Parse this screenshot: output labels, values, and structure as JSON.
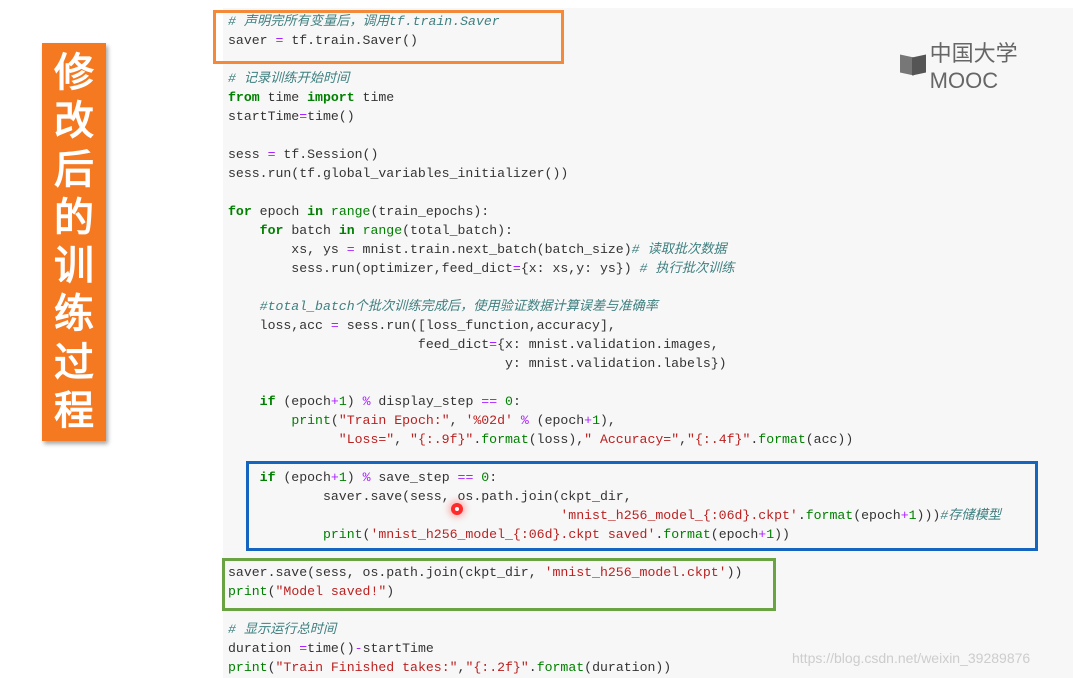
{
  "banner": {
    "chars": [
      "修",
      "改",
      "后",
      "的",
      "训",
      "练",
      "过",
      "程"
    ],
    "color": "#f47920"
  },
  "logo": {
    "text": "中国大学MOOC"
  },
  "watermark": "https://blog.csdn.net/weixin_39289876",
  "colors": {
    "comment": "#408080",
    "keyword": "#008000",
    "string": "#ba2121",
    "operator": "#aa22ff",
    "highlight_orange": "#f5893a",
    "highlight_blue": "#1565c0",
    "highlight_green": "#6aa341"
  },
  "code_lines": [
    [
      [
        "c",
        "# 声明完所有变量后，调用tf.train.Saver"
      ]
    ],
    [
      [
        "p",
        "saver "
      ],
      [
        "o",
        "="
      ],
      [
        "p",
        " tf.train.Saver()"
      ]
    ],
    [],
    [
      [
        "c",
        "# 记录训练开始时间"
      ]
    ],
    [
      [
        "k",
        "from"
      ],
      [
        "p",
        " time "
      ],
      [
        "k",
        "import"
      ],
      [
        "p",
        " time"
      ]
    ],
    [
      [
        "p",
        "startTime"
      ],
      [
        "o",
        "="
      ],
      [
        "p",
        "time()"
      ]
    ],
    [],
    [
      [
        "p",
        "sess "
      ],
      [
        "o",
        "="
      ],
      [
        "p",
        " tf.Session()"
      ]
    ],
    [
      [
        "p",
        "sess.run(tf.global_variables_initializer())"
      ]
    ],
    [],
    [
      [
        "k",
        "for"
      ],
      [
        "p",
        " epoch "
      ],
      [
        "k",
        "in"
      ],
      [
        "p",
        " "
      ],
      [
        "n",
        "range"
      ],
      [
        "p",
        "(train_epochs):"
      ]
    ],
    [
      [
        "p",
        "    "
      ],
      [
        "k",
        "for"
      ],
      [
        "p",
        " batch "
      ],
      [
        "k",
        "in"
      ],
      [
        "p",
        " "
      ],
      [
        "n",
        "range"
      ],
      [
        "p",
        "(total_batch):"
      ]
    ],
    [
      [
        "p",
        "        xs, ys "
      ],
      [
        "o",
        "="
      ],
      [
        "p",
        " mnist.train.next_batch(batch_size)"
      ],
      [
        "c",
        "# 读取批次数据"
      ]
    ],
    [
      [
        "p",
        "        sess.run(optimizer,feed_dict"
      ],
      [
        "o",
        "="
      ],
      [
        "p",
        "{x: xs,y: ys}) "
      ],
      [
        "c",
        "# 执行批次训练"
      ]
    ],
    [],
    [
      [
        "c",
        "    #total_batch个批次训练完成后，使用验证数据计算误差与准确率"
      ]
    ],
    [
      [
        "p",
        "    loss,acc "
      ],
      [
        "o",
        "="
      ],
      [
        "p",
        " sess.run([loss_function,accuracy],"
      ]
    ],
    [
      [
        "p",
        "                        feed_dict"
      ],
      [
        "o",
        "="
      ],
      [
        "p",
        "{x: mnist.validation.images,"
      ]
    ],
    [
      [
        "p",
        "                                   y: mnist.validation.labels})"
      ]
    ],
    [],
    [
      [
        "p",
        "    "
      ],
      [
        "k",
        "if"
      ],
      [
        "p",
        " (epoch"
      ],
      [
        "o",
        "+"
      ],
      [
        "n",
        "1"
      ],
      [
        "p",
        ") "
      ],
      [
        "o",
        "%"
      ],
      [
        "p",
        " display_step "
      ],
      [
        "o",
        "=="
      ],
      [
        "p",
        " "
      ],
      [
        "n",
        "0"
      ],
      [
        "p",
        ":"
      ]
    ],
    [
      [
        "p",
        "        "
      ],
      [
        "n",
        "print"
      ],
      [
        "p",
        "("
      ],
      [
        "s",
        "\"Train Epoch:\""
      ],
      [
        "p",
        ", "
      ],
      [
        "s",
        "'%02d'"
      ],
      [
        "p",
        " "
      ],
      [
        "o",
        "%"
      ],
      [
        "p",
        " (epoch"
      ],
      [
        "o",
        "+"
      ],
      [
        "n",
        "1"
      ],
      [
        "p",
        "),"
      ]
    ],
    [
      [
        "p",
        "              "
      ],
      [
        "s",
        "\"Loss=\""
      ],
      [
        "p",
        ", "
      ],
      [
        "s",
        "\"{:.9f}\""
      ],
      [
        "p",
        "."
      ],
      [
        "n",
        "format"
      ],
      [
        "p",
        "(loss),"
      ],
      [
        "s",
        "\" Accuracy=\""
      ],
      [
        "p",
        ","
      ],
      [
        "s",
        "\"{:.4f}\""
      ],
      [
        "p",
        "."
      ],
      [
        "n",
        "format"
      ],
      [
        "p",
        "(acc))"
      ]
    ],
    [],
    [
      [
        "p",
        "    "
      ],
      [
        "k",
        "if"
      ],
      [
        "p",
        " (epoch"
      ],
      [
        "o",
        "+"
      ],
      [
        "n",
        "1"
      ],
      [
        "p",
        ") "
      ],
      [
        "o",
        "%"
      ],
      [
        "p",
        " save_step "
      ],
      [
        "o",
        "=="
      ],
      [
        "p",
        " "
      ],
      [
        "n",
        "0"
      ],
      [
        "p",
        ":"
      ]
    ],
    [
      [
        "p",
        "            saver.save(sess, os.path.join(ckpt_dir,"
      ]
    ],
    [
      [
        "p",
        "                                          "
      ],
      [
        "s",
        "'mnist_h256_model_{:06d}.ckpt'"
      ],
      [
        "p",
        "."
      ],
      [
        "n",
        "format"
      ],
      [
        "p",
        "(epoch"
      ],
      [
        "o",
        "+"
      ],
      [
        "n",
        "1"
      ],
      [
        "p",
        ")))"
      ],
      [
        "c",
        "#存储模型"
      ]
    ],
    [
      [
        "p",
        "            "
      ],
      [
        "n",
        "print"
      ],
      [
        "p",
        "("
      ],
      [
        "s",
        "'mnist_h256_model_{:06d}.ckpt saved'"
      ],
      [
        "p",
        "."
      ],
      [
        "n",
        "format"
      ],
      [
        "p",
        "(epoch"
      ],
      [
        "o",
        "+"
      ],
      [
        "n",
        "1"
      ],
      [
        "p",
        "))"
      ]
    ],
    [],
    [
      [
        "p",
        "saver.save(sess, os.path.join(ckpt_dir, "
      ],
      [
        "s",
        "'mnist_h256_model.ckpt'"
      ],
      [
        "p",
        "))"
      ]
    ],
    [
      [
        "n",
        "print"
      ],
      [
        "p",
        "("
      ],
      [
        "s",
        "\"Model saved!\""
      ],
      [
        "p",
        ")"
      ]
    ],
    [],
    [
      [
        "c",
        "# 显示运行总时间"
      ]
    ],
    [
      [
        "p",
        "duration "
      ],
      [
        "o",
        "="
      ],
      [
        "p",
        "time()"
      ],
      [
        "o",
        "-"
      ],
      [
        "p",
        "startTime"
      ]
    ],
    [
      [
        "n",
        "print"
      ],
      [
        "p",
        "("
      ],
      [
        "s",
        "\"Train Finished takes:\""
      ],
      [
        "p",
        ","
      ],
      [
        "s",
        "\"{:.2f}\""
      ],
      [
        "p",
        "."
      ],
      [
        "n",
        "format"
      ],
      [
        "p",
        "(duration))"
      ]
    ]
  ]
}
